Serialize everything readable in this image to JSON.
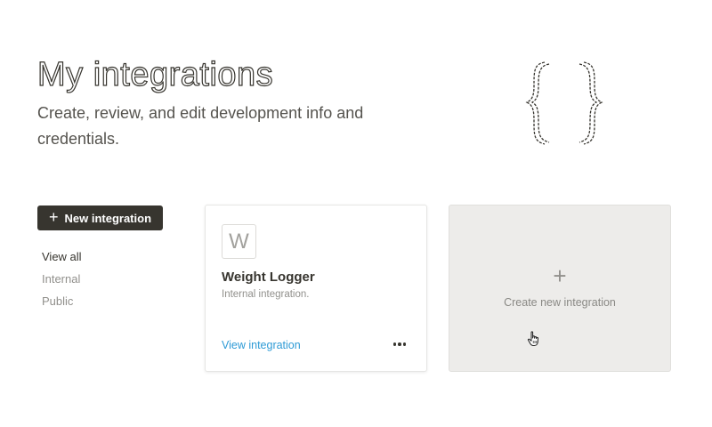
{
  "header": {
    "title": "My integrations",
    "subtitle": "Create, review, and edit development info and credentials.",
    "art_icon": "curly-braces-icon"
  },
  "sidebar": {
    "new_button_label": "New integration",
    "new_button_icon": "plus-icon",
    "filters": [
      {
        "label": "View all",
        "active": true
      },
      {
        "label": "Internal",
        "active": false
      },
      {
        "label": "Public",
        "active": false
      }
    ]
  },
  "integrations": [
    {
      "avatar_letter": "W",
      "name": "Weight Logger",
      "description": "Internal integration.",
      "link_label": "View integration",
      "menu_icon": "more-horizontal-icon"
    }
  ],
  "create_tile": {
    "plus": "+",
    "label": "Create new integration"
  },
  "colors": {
    "button_bg": "#37352f",
    "link": "#2e9bd6",
    "tile_bg": "#edecea",
    "muted_text": "#91908c"
  }
}
